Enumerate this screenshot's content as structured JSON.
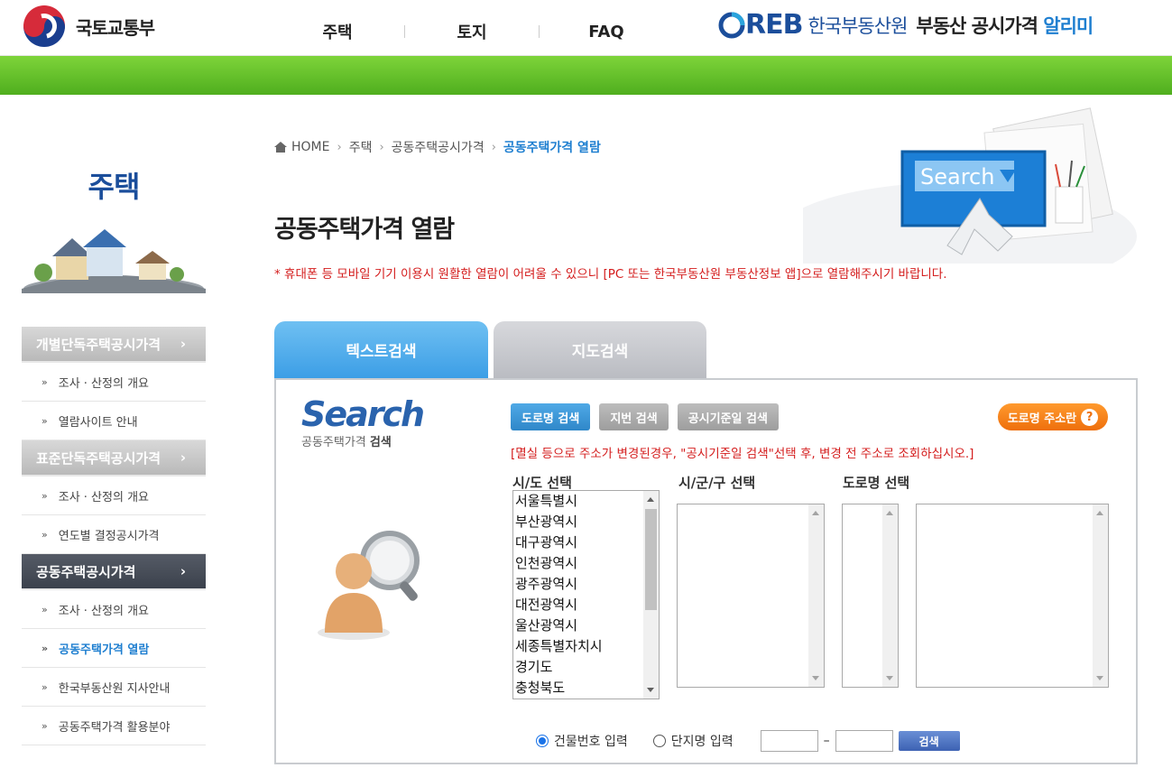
{
  "header": {
    "gov_name": "국토교통부",
    "nav": [
      {
        "label": "주택"
      },
      {
        "label": "토지"
      },
      {
        "label": "FAQ"
      }
    ],
    "reb_mark": "REB",
    "reb_org": "한국부동산원",
    "service_name": "부동산 공시가격",
    "service_accent": "알리미"
  },
  "sidebar": {
    "title": "주택",
    "sections": [
      {
        "label": "개별단독주택공시가격",
        "arrow": "›",
        "items": [
          "조사 · 산정의 개요",
          "열람사이트 안내"
        ]
      },
      {
        "label": "표준단독주택공시가격",
        "arrow": "›",
        "items": [
          "조사 · 산정의 개요",
          "연도별 결정공시가격"
        ]
      },
      {
        "label": "공동주택공시가격",
        "arrow": "›",
        "items": [
          "조사 · 산정의 개요",
          "공동주택가격 열람",
          "한국부동산원 지사안내",
          "공동주택가격 활용분야"
        ]
      }
    ],
    "bullet": "»"
  },
  "breadcrumb": {
    "home": "HOME",
    "items": [
      "주택",
      "공동주택공시가격"
    ],
    "current": "공동주택가격 열람",
    "sep": "›"
  },
  "page": {
    "title": "공동주택가격 열람",
    "notice": "* 휴대폰 등 모바일 기기 이용시 원활한 열람이 어려울 수 있으니 [PC 또는 한국부동산원 부동산정보 앱]으로 열람해주시기 바랍니다.",
    "hero_search_text": "Search"
  },
  "tabs": {
    "text_search": "텍스트검색",
    "map_search": "지도검색"
  },
  "search": {
    "logo_big": "Search",
    "logo_small_prefix": "공동주택가격",
    "logo_small_bold": "검색",
    "buttons": [
      "도로명 검색",
      "지번 검색",
      "공시기준일 검색"
    ],
    "road_help": "도로명 주소란",
    "road_help_icon": "?",
    "red_note": "[멸실 등으로 주소가 변경된경우, \"공시기준일 검색\"선택 후, 변경 전 주소로 조회하십시오.]",
    "col_sido": "시/도 선택",
    "col_sigungu": "시/군/구 선택",
    "col_road": "도로명 선택",
    "sido_options": [
      "서울특별시",
      "부산광역시",
      "대구광역시",
      "인천광역시",
      "광주광역시",
      "대전광역시",
      "울산광역시",
      "세종특별자치시",
      "경기도",
      "충청북도"
    ],
    "radio_building": "건물번호 입력",
    "radio_complex": "단지명 입력",
    "dash": "–",
    "go": "검색"
  },
  "colors": {
    "brand_blue": "#1b4e9b",
    "green_bar": "#4fae1e",
    "active_tab": "#3c9ee6",
    "notice_red": "#d41c1c",
    "help_orange": "#ee6f0c"
  }
}
